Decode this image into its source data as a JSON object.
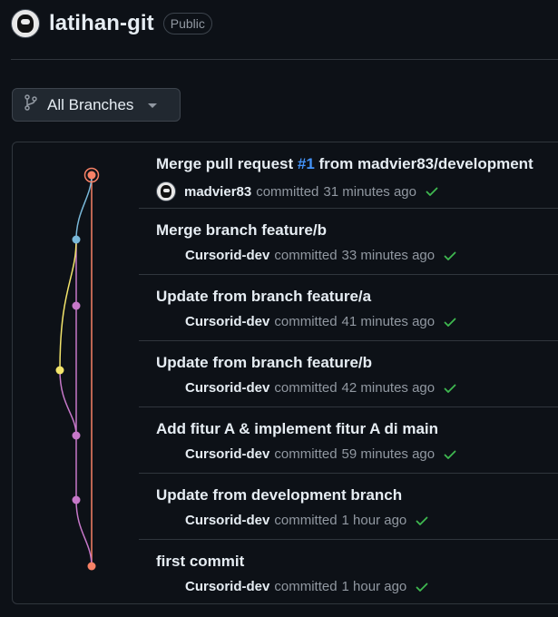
{
  "repo": {
    "name": "latihan-git",
    "visibility": "Public"
  },
  "branch_selector": {
    "label": "All Branches"
  },
  "graph": {
    "colors": {
      "red": "#f78166",
      "blue": "#79b8d9",
      "yellow": "#f2e46b",
      "purple": "#c678c9"
    }
  },
  "commits": [
    {
      "message_prefix": "Merge pull request ",
      "pr_ref": "#1",
      "message_suffix": " from madvier83/development",
      "author": "madvier83",
      "verb": "committed",
      "time": "31 minutes ago",
      "has_avatar": true,
      "status": "success"
    },
    {
      "message": "Merge branch feature/b",
      "author": "Cursorid-dev",
      "verb": "committed",
      "time": "33 minutes ago",
      "status": "success"
    },
    {
      "message": "Update from branch feature/a",
      "author": "Cursorid-dev",
      "verb": "committed",
      "time": "41 minutes ago",
      "status": "success"
    },
    {
      "message": "Update from branch feature/b",
      "author": "Cursorid-dev",
      "verb": "committed",
      "time": "42 minutes ago",
      "status": "success"
    },
    {
      "message": "Add fitur A & implement fitur A di main",
      "author": "Cursorid-dev",
      "verb": "committed",
      "time": "59 minutes ago",
      "status": "success"
    },
    {
      "message": "Update from development branch",
      "author": "Cursorid-dev",
      "verb": "committed",
      "time": "1 hour ago",
      "status": "success"
    },
    {
      "message": "first commit",
      "author": "Cursorid-dev",
      "verb": "committed",
      "time": "1 hour ago",
      "status": "success"
    }
  ],
  "status_color": "#3fb950"
}
